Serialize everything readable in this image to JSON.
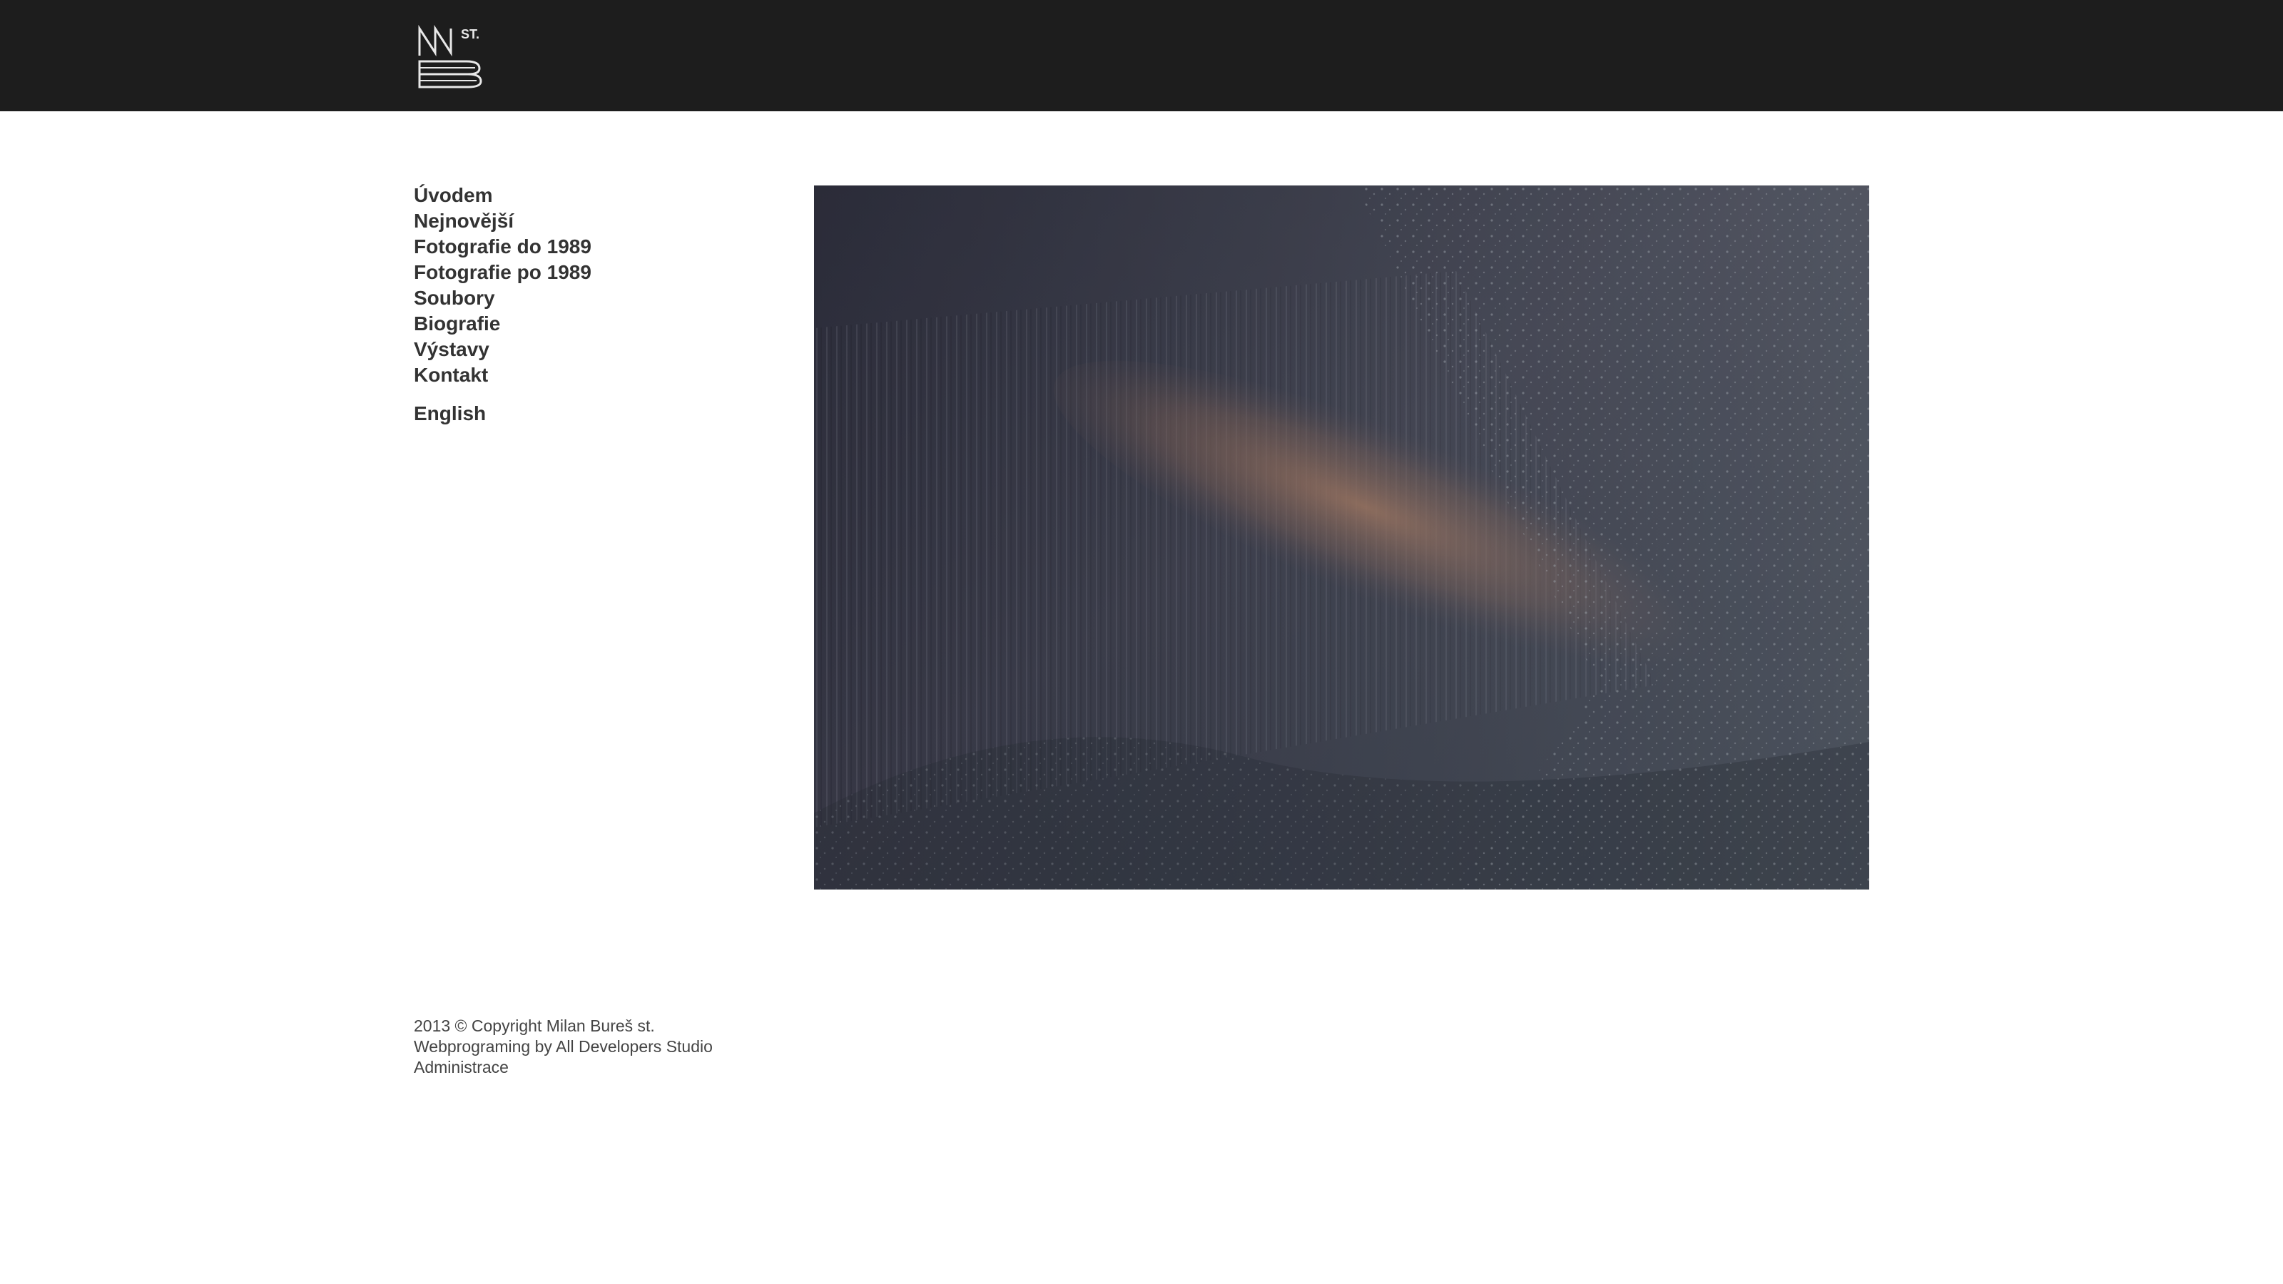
{
  "header": {
    "logo_text": "MB st."
  },
  "nav": {
    "items": [
      {
        "label": "Úvodem"
      },
      {
        "label": "Nejnovější"
      },
      {
        "label": "Fotografie do 1989"
      },
      {
        "label": "Fotografie po 1989"
      },
      {
        "label": "Soubory"
      },
      {
        "label": "Biografie"
      },
      {
        "label": "Výstavy"
      },
      {
        "label": "Kontakt"
      }
    ],
    "language": "English"
  },
  "photo": {
    "subject": "snowy forest hillside with a band of orange-lit trees"
  },
  "footer": {
    "copyright": "2013 © Copyright Milan Bureš st.",
    "credit": "Webprograming by All Developers Studio",
    "admin": "Administrace"
  },
  "colors": {
    "header_bg": "#1d1d1d",
    "nav_text": "#333333",
    "footer_text": "#444444"
  }
}
